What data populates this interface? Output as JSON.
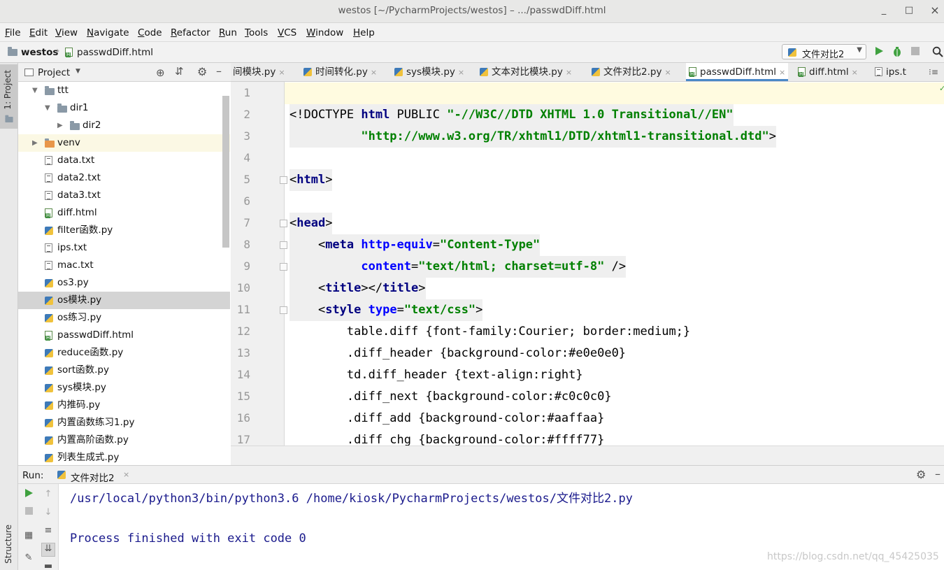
{
  "window": {
    "title": "westos [~/PycharmProjects/westos] – .../passwdDiff.html",
    "minimize": "_",
    "maximize": "□",
    "close": "×"
  },
  "menu": [
    "File",
    "Edit",
    "View",
    "Navigate",
    "Code",
    "Refactor",
    "Run",
    "Tools",
    "VCS",
    "Window",
    "Help"
  ],
  "breadcrumb": {
    "project": "westos",
    "file": "passwdDiff.html"
  },
  "run_config": {
    "label": "文件对比2",
    "dropdown": "▼"
  },
  "toolbar_icons": [
    "run-icon",
    "debug-icon",
    "stop-icon",
    "search-icon"
  ],
  "left_strip": {
    "project_tab": "1: Project",
    "structure_tab": "Structure"
  },
  "project_panel": {
    "title": "Project",
    "tree": [
      {
        "name": "ttt",
        "type": "folder",
        "depth": 0,
        "expanded": true
      },
      {
        "name": "dir1",
        "type": "folder",
        "depth": 1,
        "expanded": true
      },
      {
        "name": "dir2",
        "type": "folder",
        "depth": 2
      },
      {
        "name": "venv",
        "type": "venv",
        "depth": 0,
        "expanded": false
      },
      {
        "name": "data.txt",
        "type": "txt",
        "depth": 0
      },
      {
        "name": "data2.txt",
        "type": "txt",
        "depth": 0
      },
      {
        "name": "data3.txt",
        "type": "txt",
        "depth": 0
      },
      {
        "name": "diff.html",
        "type": "html",
        "depth": 0
      },
      {
        "name": "filter函数.py",
        "type": "py",
        "depth": 0
      },
      {
        "name": "ips.txt",
        "type": "txt",
        "depth": 0
      },
      {
        "name": "mac.txt",
        "type": "txt",
        "depth": 0
      },
      {
        "name": "os3.py",
        "type": "py",
        "depth": 0
      },
      {
        "name": "os模块.py",
        "type": "py",
        "depth": 0,
        "selected": true
      },
      {
        "name": "os练习.py",
        "type": "py",
        "depth": 0
      },
      {
        "name": "passwdDiff.html",
        "type": "html",
        "depth": 0
      },
      {
        "name": "reduce函数.py",
        "type": "py",
        "depth": 0
      },
      {
        "name": "sort函数.py",
        "type": "py",
        "depth": 0
      },
      {
        "name": "sys模块.py",
        "type": "py",
        "depth": 0
      },
      {
        "name": "内推码.py",
        "type": "py",
        "depth": 0
      },
      {
        "name": "内置函数练习1.py",
        "type": "py",
        "depth": 0
      },
      {
        "name": "内置高阶函数.py",
        "type": "py",
        "depth": 0
      },
      {
        "name": "列表生成式.py",
        "type": "py",
        "depth": 0
      }
    ]
  },
  "editor_tabs": [
    {
      "label": "间模块.py",
      "icon": "py"
    },
    {
      "label": "时间转化.py",
      "icon": "py"
    },
    {
      "label": "sys模块.py",
      "icon": "py"
    },
    {
      "label": "文本对比模块.py",
      "icon": "py"
    },
    {
      "label": "文件对比2.py",
      "icon": "py"
    },
    {
      "label": "passwdDiff.html",
      "icon": "html",
      "active": true
    },
    {
      "label": "diff.html",
      "icon": "html"
    },
    {
      "label": "ips.t",
      "icon": "txt"
    }
  ],
  "tab_close": "×",
  "code_lines": [
    {
      "n": "1",
      "parts": []
    },
    {
      "n": "2",
      "parts": [
        [
          "pl",
          "<!DOCTYPE "
        ],
        [
          "tg",
          "html"
        ],
        [
          "pl",
          " PUBLIC "
        ],
        [
          "st",
          "\"-//W3C//DTD XHTML 1.0 Transitional//EN\""
        ]
      ]
    },
    {
      "n": "3",
      "parts": [
        [
          "pl",
          "          "
        ],
        [
          "st",
          "\"http://www.w3.org/TR/xhtml1/DTD/xhtml1-transitional.dtd\""
        ],
        [
          "pl",
          ">"
        ]
      ]
    },
    {
      "n": "4",
      "parts": []
    },
    {
      "n": "5",
      "parts": [
        [
          "pl",
          "<"
        ],
        [
          "tg",
          "html"
        ],
        [
          "pl",
          ">"
        ]
      ]
    },
    {
      "n": "6",
      "parts": []
    },
    {
      "n": "7",
      "parts": [
        [
          "pl",
          "<"
        ],
        [
          "tg",
          "head"
        ],
        [
          "pl",
          ">"
        ]
      ]
    },
    {
      "n": "8",
      "parts": [
        [
          "pl",
          "    <"
        ],
        [
          "tg",
          "meta "
        ],
        [
          "at",
          "http-equiv"
        ],
        [
          "pl",
          "="
        ],
        [
          "st",
          "\"Content-Type\""
        ]
      ]
    },
    {
      "n": "9",
      "parts": [
        [
          "pl",
          "          "
        ],
        [
          "at",
          "content"
        ],
        [
          "pl",
          "="
        ],
        [
          "st",
          "\"text/html; charset=utf-8\""
        ],
        [
          "pl",
          " />"
        ]
      ]
    },
    {
      "n": "10",
      "parts": [
        [
          "pl",
          "    <"
        ],
        [
          "tg",
          "title"
        ],
        [
          "pl",
          "></"
        ],
        [
          "tg",
          "title"
        ],
        [
          "pl",
          ">"
        ]
      ]
    },
    {
      "n": "11",
      "parts": [
        [
          "pl",
          "    <"
        ],
        [
          "tg",
          "style "
        ],
        [
          "at",
          "type"
        ],
        [
          "pl",
          "="
        ],
        [
          "st",
          "\"text/css\""
        ],
        [
          "pl",
          ">"
        ]
      ]
    },
    {
      "n": "12",
      "parts": [
        [
          "pl",
          "        table.diff {font-family:Courier; border:medium;}"
        ]
      ]
    },
    {
      "n": "13",
      "parts": [
        [
          "pl",
          "        .diff_header {background-color:#e0e0e0}"
        ]
      ]
    },
    {
      "n": "14",
      "parts": [
        [
          "pl",
          "        td.diff_header {text-align:right}"
        ]
      ]
    },
    {
      "n": "15",
      "parts": [
        [
          "pl",
          "        .diff_next {background-color:#c0c0c0}"
        ]
      ]
    },
    {
      "n": "16",
      "parts": [
        [
          "pl",
          "        .diff_add {background-color:#aaffaa}"
        ]
      ]
    },
    {
      "n": "17",
      "parts": [
        [
          "pl",
          "        .diff_chg {background-color:#ffff77}"
        ]
      ]
    }
  ],
  "run_panel": {
    "label": "Run:",
    "tab": "文件对比2",
    "console": [
      "/usr/local/python3/bin/python3.6 /home/kiosk/PycharmProjects/westos/文件对比2.py",
      "",
      "Process finished with exit code 0"
    ]
  },
  "watermark": "https://blog.csdn.net/qq_45425035",
  "colors": {
    "tag": "#000080",
    "attribute": "#0000ff",
    "string": "#008000",
    "console_text": "#1a1a8c",
    "active_tab_underline": "#4a88c7",
    "run_green": "#3fa13f"
  }
}
